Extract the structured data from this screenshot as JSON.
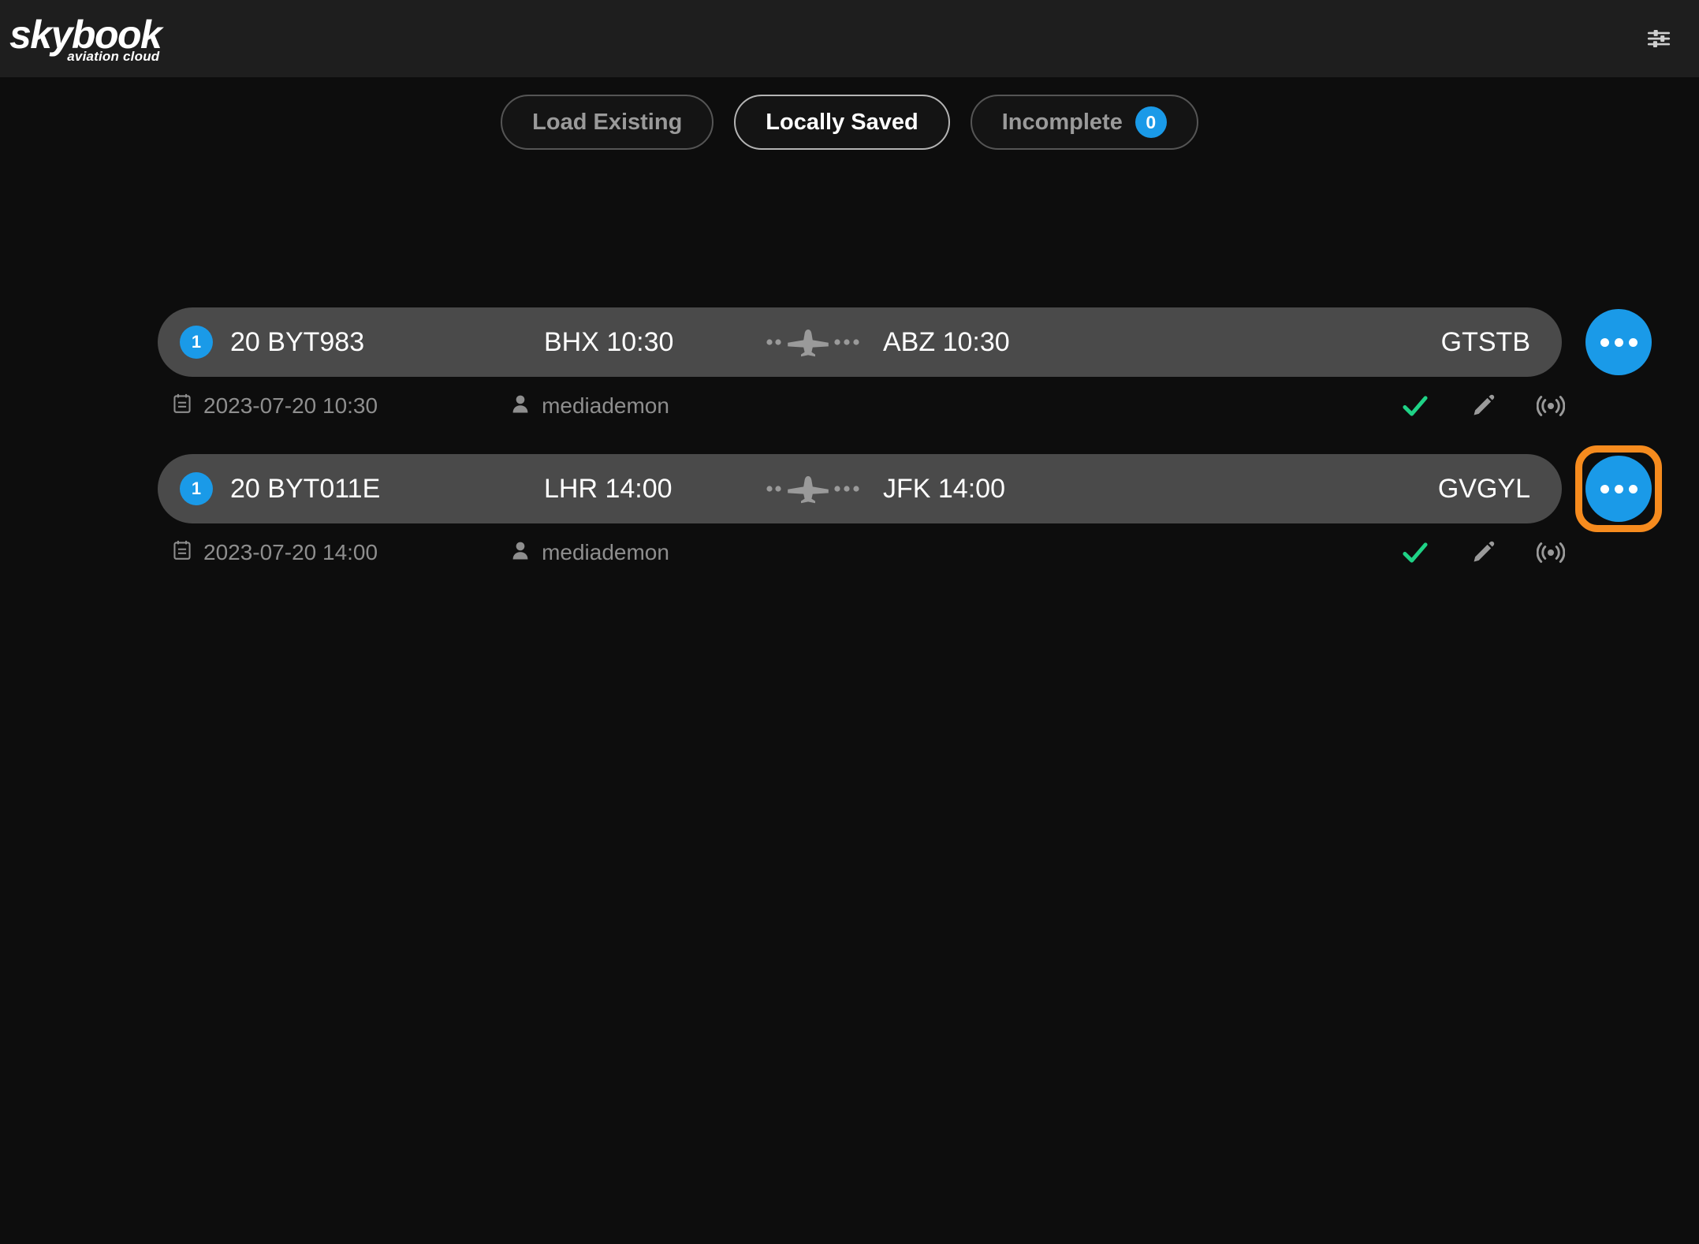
{
  "header": {
    "logo_main": "skybook",
    "logo_sub": "aviation cloud",
    "settings_icon": "sliders-settings-icon"
  },
  "tabs": [
    {
      "label": "Load Existing",
      "active": false,
      "badge": null
    },
    {
      "label": "Locally Saved",
      "active": true,
      "badge": null
    },
    {
      "label": "Incomplete",
      "active": false,
      "badge": "0"
    }
  ],
  "flights": [
    {
      "sequence": "1",
      "flight_number": "20 BYT983",
      "departure": "BHX 10:30",
      "arrival": "ABZ 10:30",
      "tail_number": "GTSTB",
      "date": "2023-07-20 10:30",
      "user": "mediademon",
      "more_label": "more-options",
      "highlighted": false
    },
    {
      "sequence": "1",
      "flight_number": "20 BYT011E",
      "departure": "LHR 14:00",
      "arrival": "JFK 14:00",
      "tail_number": "GVGYL",
      "date": "2023-07-20 14:00",
      "user": "mediademon",
      "more_label": "more-options",
      "highlighted": true
    }
  ],
  "icons": {
    "calendar": "calendar-icon",
    "user": "person-icon",
    "check": "check-icon",
    "edit": "pencil-icon",
    "broadcast": "broadcast-icon",
    "plane": "airplane-icon"
  },
  "colors": {
    "accent_blue": "#1a9ae8",
    "highlight_orange": "#f68b1e",
    "check_green": "#1fd286",
    "row_background": "#4a4a4a",
    "page_background": "#0d0d0d",
    "header_background": "#1e1e1e"
  }
}
